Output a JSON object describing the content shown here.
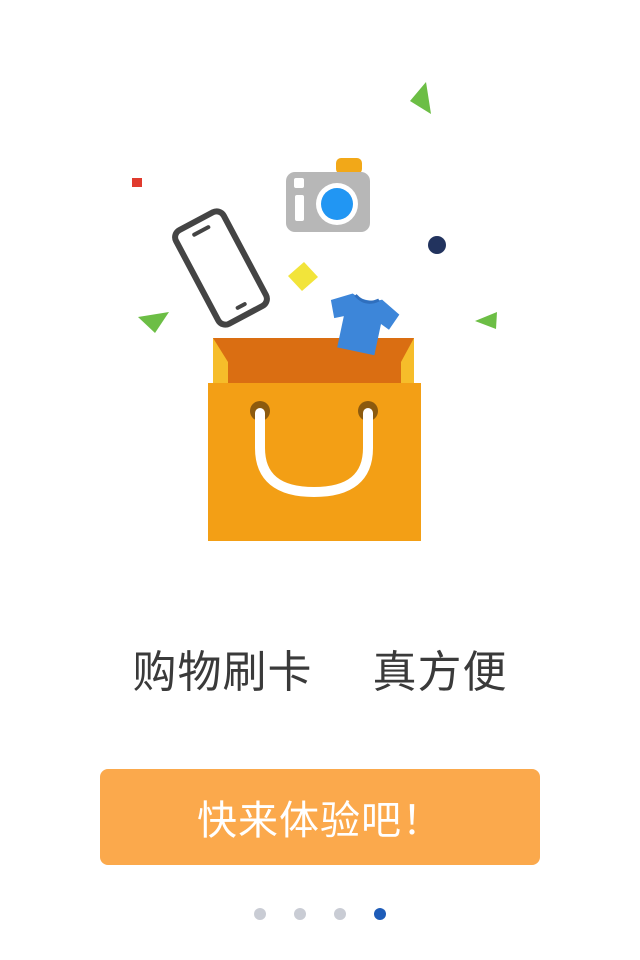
{
  "onboarding": {
    "tagline": "购物刷卡　 真方便",
    "cta_label": "快来体验吧！",
    "page_indicator": {
      "total": 4,
      "current": 4
    }
  },
  "colors": {
    "cta_background": "#FBA94C",
    "cta_text": "#FFFFFF",
    "tagline": "#3A3A3A",
    "dot_inactive": "#C9CCD4",
    "dot_active": "#1E5CB8",
    "bag_body": "#F39F15",
    "bag_inner": "#DA6E12",
    "confetti_green": "#6CBE45",
    "confetti_red": "#E03B2E",
    "confetti_yellow": "#F2E43A",
    "confetti_navy": "#22335E",
    "camera_lens": "#2196F3",
    "shirt": "#3D86D9"
  },
  "illustration": {
    "objects": [
      "shopping-bag-icon",
      "phone-icon",
      "camera-icon",
      "t-shirt-icon",
      "confetti"
    ]
  }
}
